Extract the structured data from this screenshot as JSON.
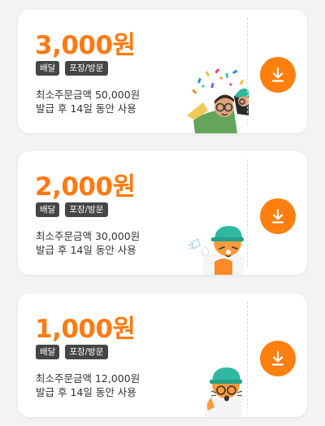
{
  "coupons": [
    {
      "amount": "3,000원",
      "tags": [
        "배달",
        "포장/방문"
      ],
      "min_order": "최소주문금액 50,000원",
      "validity": "발급 후 14일 동안 사용",
      "character": "two-characters-confetti"
    },
    {
      "amount": "2,000원",
      "tags": [
        "배달",
        "포장/방문"
      ],
      "min_order": "최소주문금액 30,000원",
      "validity": "발급 후 14일 동안 사용",
      "character": "cat-character-cap"
    },
    {
      "amount": "1,000원",
      "tags": [
        "배달",
        "포장/방문"
      ],
      "min_order": "최소주문금액 12,000원",
      "validity": "발급 후 14일 동안 사용",
      "character": "cat-character-glasses"
    }
  ],
  "colors": {
    "accent": "#ff7a12",
    "tag_bg": "#454545",
    "background": "#f3f3f5"
  },
  "icons": {
    "download": "download-arrow-icon"
  }
}
